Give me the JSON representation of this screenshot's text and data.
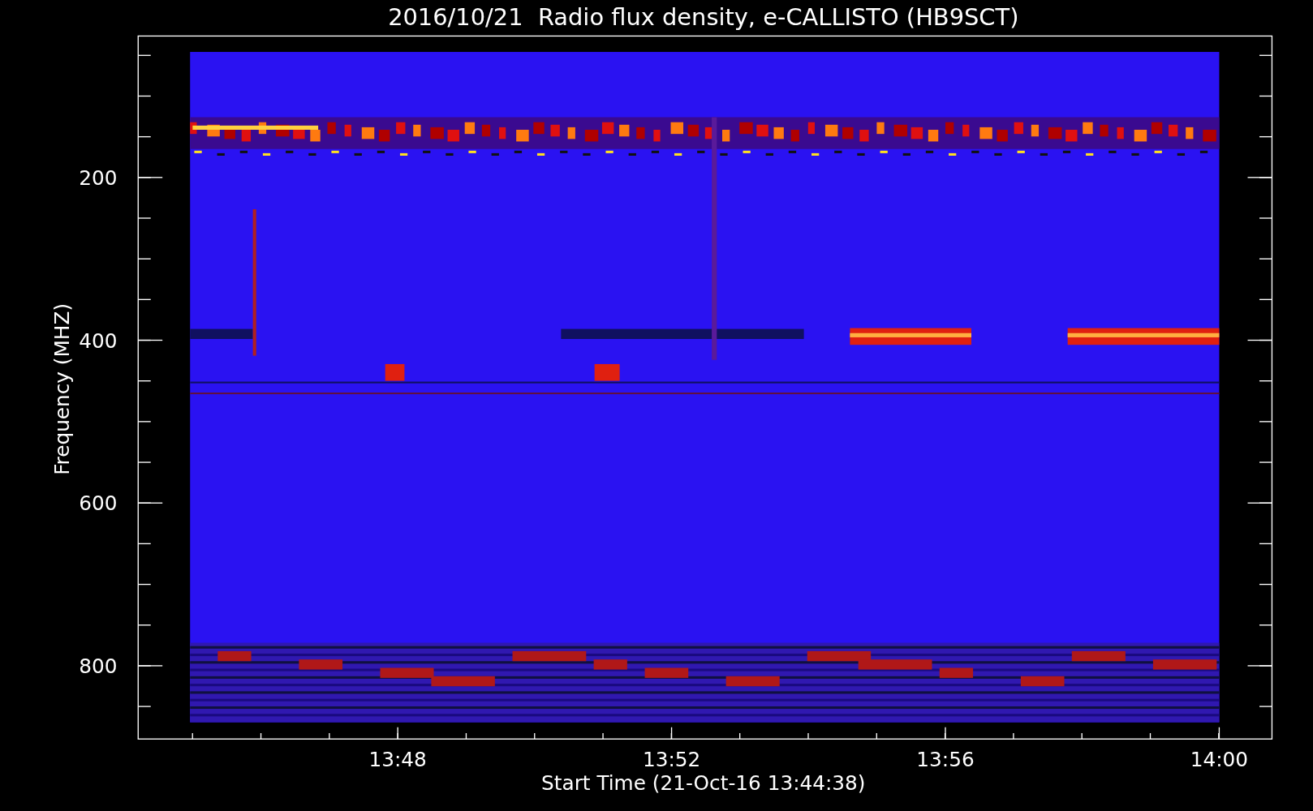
{
  "title": "2016/10/21  Radio flux density, e-CALLISTO (HB9SCT)",
  "y_axis": {
    "label": "Frequency (MHZ)",
    "ticks": [
      "200",
      "400",
      "600",
      "800"
    ]
  },
  "x_axis": {
    "label": "Start Time (21-Oct-16 13:44:38)",
    "ticks": [
      "13:48",
      "13:52",
      "13:56",
      "14:00"
    ]
  }
}
